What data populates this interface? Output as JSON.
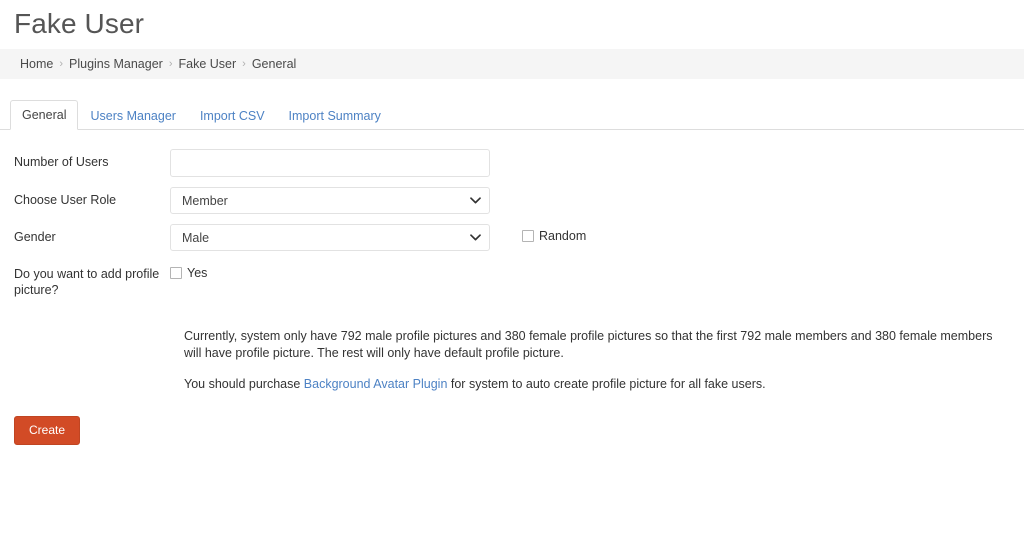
{
  "page": {
    "title": "Fake User"
  },
  "breadcrumb": {
    "separator": "›",
    "items": [
      {
        "label": "Home"
      },
      {
        "label": "Plugins Manager"
      },
      {
        "label": "Fake User"
      },
      {
        "label": "General"
      }
    ]
  },
  "tabs": [
    {
      "label": "General",
      "active": true
    },
    {
      "label": "Users Manager",
      "active": false
    },
    {
      "label": "Import CSV",
      "active": false
    },
    {
      "label": "Import Summary",
      "active": false
    }
  ],
  "form": {
    "number_of_users": {
      "label": "Number of Users",
      "value": "",
      "placeholder": ""
    },
    "user_role": {
      "label": "Choose User Role",
      "value": "Member"
    },
    "gender": {
      "label": "Gender",
      "value": "Male",
      "random_label": "Random",
      "random_checked": false
    },
    "profile_picture": {
      "label": "Do you want to add profile picture?",
      "yes_label": "Yes",
      "yes_checked": false
    }
  },
  "notes": {
    "paragraph1": "Currently, system only have 792 male profile pictures and 380 female profile pictures so that the first 792 male members and 380 female members will have profile picture. The rest will only have default profile picture.",
    "paragraph2_before": "You should purchase ",
    "paragraph2_link": "Background Avatar Plugin",
    "paragraph2_after": " for system to auto create profile picture for all fake users."
  },
  "actions": {
    "create_label": "Create"
  },
  "colors": {
    "accent": "#d24b26",
    "link": "#4d82c4",
    "breadcrumb_bg": "#f5f5f5",
    "border": "#e2e2e2"
  }
}
